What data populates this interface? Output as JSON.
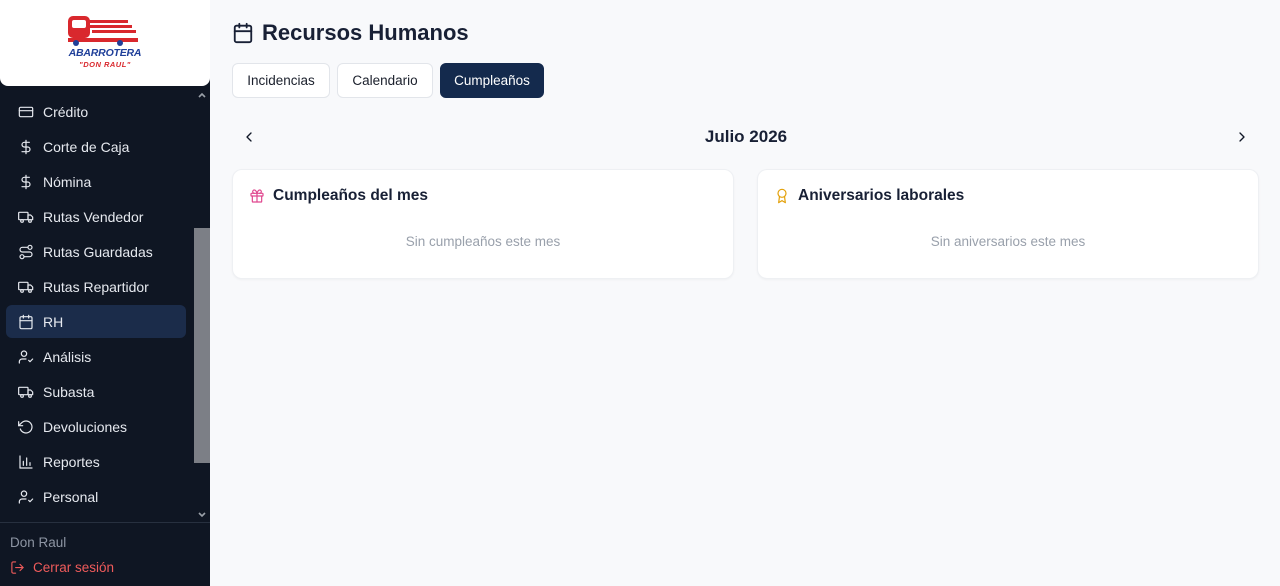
{
  "brand": {
    "name": "ABARROTERA",
    "subtitle": "\"DON RAUL\""
  },
  "sidebar": {
    "items": [
      {
        "label": "Crédito",
        "icon": "credit-card-icon"
      },
      {
        "label": "Corte de Caja",
        "icon": "dollar-icon"
      },
      {
        "label": "Nómina",
        "icon": "dollar-icon"
      },
      {
        "label": "Rutas Vendedor",
        "icon": "truck-icon"
      },
      {
        "label": "Rutas Guardadas",
        "icon": "route-icon"
      },
      {
        "label": "Rutas Repartidor",
        "icon": "truck-icon"
      },
      {
        "label": "RH",
        "icon": "calendar-icon",
        "active": true
      },
      {
        "label": "Análisis",
        "icon": "user-check-icon"
      },
      {
        "label": "Subasta",
        "icon": "truck-icon"
      },
      {
        "label": "Devoluciones",
        "icon": "rotate-ccw-icon"
      },
      {
        "label": "Reportes",
        "icon": "bar-chart-icon"
      },
      {
        "label": "Personal",
        "icon": "user-check-icon"
      }
    ],
    "user_name": "Don Raul",
    "logout_label": "Cerrar sesión"
  },
  "header": {
    "title": "Recursos Humanos",
    "title_icon": "calendar-icon"
  },
  "tabs": [
    {
      "label": "Incidencias",
      "active": false
    },
    {
      "label": "Calendario",
      "active": false
    },
    {
      "label": "Cumpleaños",
      "active": true
    }
  ],
  "month_nav": {
    "label": "Julio 2026"
  },
  "cards": {
    "birthdays": {
      "title": "Cumpleaños del mes",
      "icon": "gift-icon",
      "icon_color": "#e0488f",
      "empty_text": "Sin cumpleaños este mes"
    },
    "anniversaries": {
      "title": "Aniversarios laborales",
      "icon": "award-icon",
      "icon_color": "#e3a008",
      "empty_text": "Sin aniversarios este mes"
    }
  },
  "colors": {
    "sidebar_bg": "#0f1623",
    "active_item_bg": "#1b2c4a",
    "active_tab_bg": "#142a4d",
    "logout": "#ef5b5b"
  }
}
